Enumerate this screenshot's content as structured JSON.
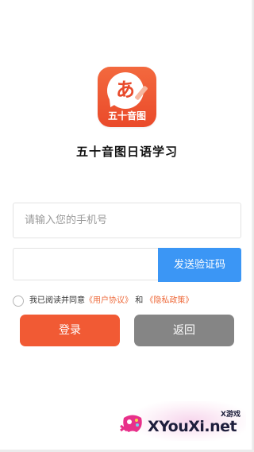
{
  "app": {
    "icon_kana": "あ",
    "icon_caption": "五十音图",
    "title": "五十音图日语学习"
  },
  "form": {
    "phone_placeholder": "请输入您的手机号",
    "phone_value": "",
    "code_value": "",
    "send_code_label": "发送验证码"
  },
  "agreement": {
    "prefix": "我已阅读并同意",
    "user_agreement": "《用户协议》",
    "and": "和",
    "privacy_policy": "《隐私政策》"
  },
  "buttons": {
    "login_label": "登录",
    "back_label": "返回"
  },
  "watermark": {
    "text": "XYouXi.net",
    "small": "X游戏"
  },
  "colors": {
    "brand_orange": "#f15a34",
    "send_code_blue": "#3b96f5",
    "back_gray": "#858585",
    "link_orange": "#ee6a3b"
  }
}
